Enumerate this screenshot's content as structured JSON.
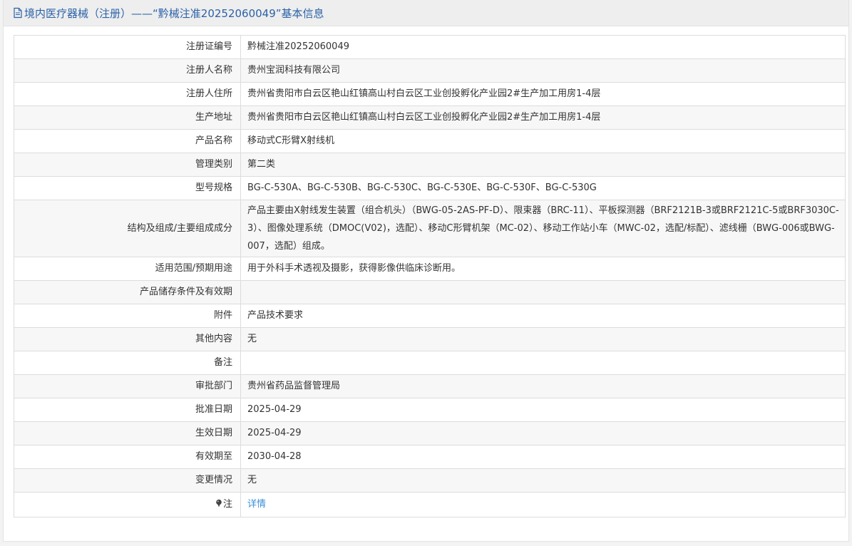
{
  "header": {
    "title": "境内医疗器械（注册）——“黔械注准20252060049”基本信息"
  },
  "rows": [
    {
      "label": "注册证编号",
      "value": "黔械注准20252060049"
    },
    {
      "label": "注册人名称",
      "value": "贵州宝润科技有限公司"
    },
    {
      "label": "注册人住所",
      "value": "贵州省贵阳市白云区艳山红镇高山村白云区工业创投孵化产业园2#生产加工用房1-4层"
    },
    {
      "label": "生产地址",
      "value": "贵州省贵阳市白云区艳山红镇高山村白云区工业创投孵化产业园2#生产加工用房1-4层"
    },
    {
      "label": "产品名称",
      "value": "移动式C形臂X射线机"
    },
    {
      "label": "管理类别",
      "value": "第二类"
    },
    {
      "label": "型号规格",
      "value": "BG-C-530A、BG-C-530B、BG-C-530C、BG-C-530E、BG-C-530F、BG-C-530G"
    },
    {
      "label": "结构及组成/主要组成成分",
      "value": "产品主要由X射线发生装置（组合机头）（BWG-05-2AS-PF-D）、限束器（BRC-11）、平板探测器（BRF2121B-3或BRF2121C-5或BRF3030C-3）、图像处理系统（DMOC(V02)，选配）、移动C形臂机架（MC-02）、移动工作站小车（MWC-02，选配/标配）、滤线栅（BWG-006或BWG-007，选配）组成。"
    },
    {
      "label": "适用范围/预期用途",
      "value": "用于外科手术透视及摄影，获得影像供临床诊断用。"
    },
    {
      "label": "产品储存条件及有效期",
      "value": ""
    },
    {
      "label": "附件",
      "value": "产品技术要求"
    },
    {
      "label": "其他内容",
      "value": "无"
    },
    {
      "label": "备注",
      "value": ""
    },
    {
      "label": "审批部门",
      "value": "贵州省药品监督管理局"
    },
    {
      "label": "批准日期",
      "value": "2025-04-29"
    },
    {
      "label": "生效日期",
      "value": "2025-04-29"
    },
    {
      "label": "有效期至",
      "value": "2030-04-28"
    },
    {
      "label": "变更情况",
      "value": "无"
    }
  ],
  "note": {
    "label": "注",
    "link": "详情"
  },
  "colors": {
    "header_text": "#2b62a8",
    "link": "#3a8fd6"
  },
  "icons": {
    "header": "document-icon",
    "note": "pin-icon"
  }
}
